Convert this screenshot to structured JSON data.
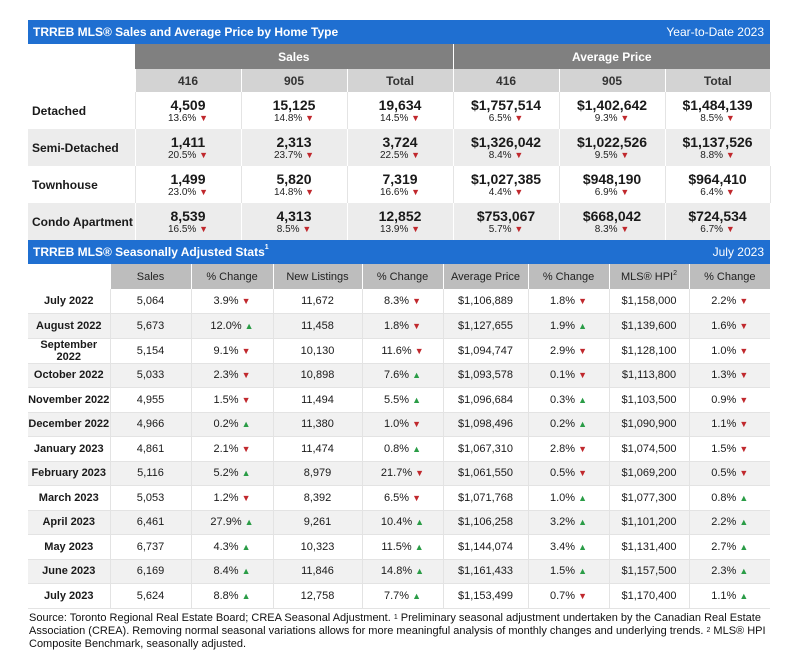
{
  "sales_panel": {
    "title": "TRREB MLS® Sales and Average Price by Home Type",
    "period": "Year-to-Date 2023",
    "group_sales": "Sales",
    "group_price": "Average Price",
    "cols": [
      "416",
      "905",
      "Total",
      "416",
      "905",
      "Total"
    ],
    "rows": [
      {
        "type": "Detached",
        "cells": [
          [
            "4,509",
            "13.6%",
            "down"
          ],
          [
            "15,125",
            "14.8%",
            "down"
          ],
          [
            "19,634",
            "14.5%",
            "down"
          ],
          [
            "$1,757,514",
            "6.5%",
            "down"
          ],
          [
            "$1,402,642",
            "9.3%",
            "down"
          ],
          [
            "$1,484,139",
            "8.5%",
            "down"
          ]
        ]
      },
      {
        "type": "Semi-Detached",
        "cells": [
          [
            "1,411",
            "20.5%",
            "down"
          ],
          [
            "2,313",
            "23.7%",
            "down"
          ],
          [
            "3,724",
            "22.5%",
            "down"
          ],
          [
            "$1,326,042",
            "8.4%",
            "down"
          ],
          [
            "$1,022,526",
            "9.5%",
            "down"
          ],
          [
            "$1,137,526",
            "8.8%",
            "down"
          ]
        ]
      },
      {
        "type": "Townhouse",
        "cells": [
          [
            "1,499",
            "23.0%",
            "down"
          ],
          [
            "5,820",
            "14.8%",
            "down"
          ],
          [
            "7,319",
            "16.6%",
            "down"
          ],
          [
            "$1,027,385",
            "4.4%",
            "down"
          ],
          [
            "$948,190",
            "6.9%",
            "down"
          ],
          [
            "$964,410",
            "6.4%",
            "down"
          ]
        ]
      },
      {
        "type": "Condo Apartment",
        "cells": [
          [
            "8,539",
            "16.5%",
            "down"
          ],
          [
            "4,313",
            "8.5%",
            "down"
          ],
          [
            "12,852",
            "13.9%",
            "down"
          ],
          [
            "$753,067",
            "5.7%",
            "down"
          ],
          [
            "$668,042",
            "8.3%",
            "down"
          ],
          [
            "$724,534",
            "6.7%",
            "down"
          ]
        ]
      }
    ]
  },
  "seasonal_panel": {
    "title": "TRREB MLS® Seasonally Adjusted Stats",
    "title_sup": "1",
    "period": "July 2023",
    "headers": [
      "Sales",
      "% Change",
      "New Listings",
      "% Change",
      "Average Price",
      "% Change",
      "MLS® HPI",
      "% Change"
    ],
    "hpi_sup": "2",
    "rows": [
      [
        "July 2022",
        "5,064",
        "3.9%",
        "down",
        "11,672",
        "8.3%",
        "down",
        "$1,106,889",
        "1.8%",
        "down",
        "$1,158,000",
        "2.2%",
        "down"
      ],
      [
        "August 2022",
        "5,673",
        "12.0%",
        "up",
        "11,458",
        "1.8%",
        "down",
        "$1,127,655",
        "1.9%",
        "up",
        "$1,139,600",
        "1.6%",
        "down"
      ],
      [
        "September 2022",
        "5,154",
        "9.1%",
        "down",
        "10,130",
        "11.6%",
        "down",
        "$1,094,747",
        "2.9%",
        "down",
        "$1,128,100",
        "1.0%",
        "down"
      ],
      [
        "October 2022",
        "5,033",
        "2.3%",
        "down",
        "10,898",
        "7.6%",
        "up",
        "$1,093,578",
        "0.1%",
        "down",
        "$1,113,800",
        "1.3%",
        "down"
      ],
      [
        "November 2022",
        "4,955",
        "1.5%",
        "down",
        "11,494",
        "5.5%",
        "up",
        "$1,096,684",
        "0.3%",
        "up",
        "$1,103,500",
        "0.9%",
        "down"
      ],
      [
        "December 2022",
        "4,966",
        "0.2%",
        "up",
        "11,380",
        "1.0%",
        "down",
        "$1,098,496",
        "0.2%",
        "up",
        "$1,090,900",
        "1.1%",
        "down"
      ],
      [
        "January 2023",
        "4,861",
        "2.1%",
        "down",
        "11,474",
        "0.8%",
        "up",
        "$1,067,310",
        "2.8%",
        "down",
        "$1,074,500",
        "1.5%",
        "down"
      ],
      [
        "February 2023",
        "5,116",
        "5.2%",
        "up",
        "8,979",
        "21.7%",
        "down",
        "$1,061,550",
        "0.5%",
        "down",
        "$1,069,200",
        "0.5%",
        "down"
      ],
      [
        "March 2023",
        "5,053",
        "1.2%",
        "down",
        "8,392",
        "6.5%",
        "down",
        "$1,071,768",
        "1.0%",
        "up",
        "$1,077,300",
        "0.8%",
        "up"
      ],
      [
        "April 2023",
        "6,461",
        "27.9%",
        "up",
        "9,261",
        "10.4%",
        "up",
        "$1,106,258",
        "3.2%",
        "up",
        "$1,101,200",
        "2.2%",
        "up"
      ],
      [
        "May 2023",
        "6,737",
        "4.3%",
        "up",
        "10,323",
        "11.5%",
        "up",
        "$1,144,074",
        "3.4%",
        "up",
        "$1,131,400",
        "2.7%",
        "up"
      ],
      [
        "June 2023",
        "6,169",
        "8.4%",
        "up",
        "11,846",
        "14.8%",
        "up",
        "$1,161,433",
        "1.5%",
        "up",
        "$1,157,500",
        "2.3%",
        "up"
      ],
      [
        "July 2023",
        "5,624",
        "8.8%",
        "up",
        "12,758",
        "7.7%",
        "up",
        "$1,153,499",
        "0.7%",
        "down",
        "$1,170,400",
        "1.1%",
        "up"
      ]
    ]
  },
  "footnote": {
    "p1": "Source: Toronto Regional Real Estate Board; CREA Seasonal Adjustment. ",
    "s1": "1",
    "p2": " Preliminary seasonal adjustment undertaken by the Canadian Real Estate Association (CREA).  Removing normal seasonal variations allows for more meaningful analysis of monthly changes and underlying trends. ",
    "s2": "2",
    "p3": " MLS® HPI Composite Benchmark, seasonally adjusted."
  },
  "icons": {
    "down": "▼",
    "up": "▲"
  },
  "colors": {
    "header_blue": "#1f6fd1",
    "down_red": "#c0282d",
    "up_green": "#2a9c46"
  }
}
